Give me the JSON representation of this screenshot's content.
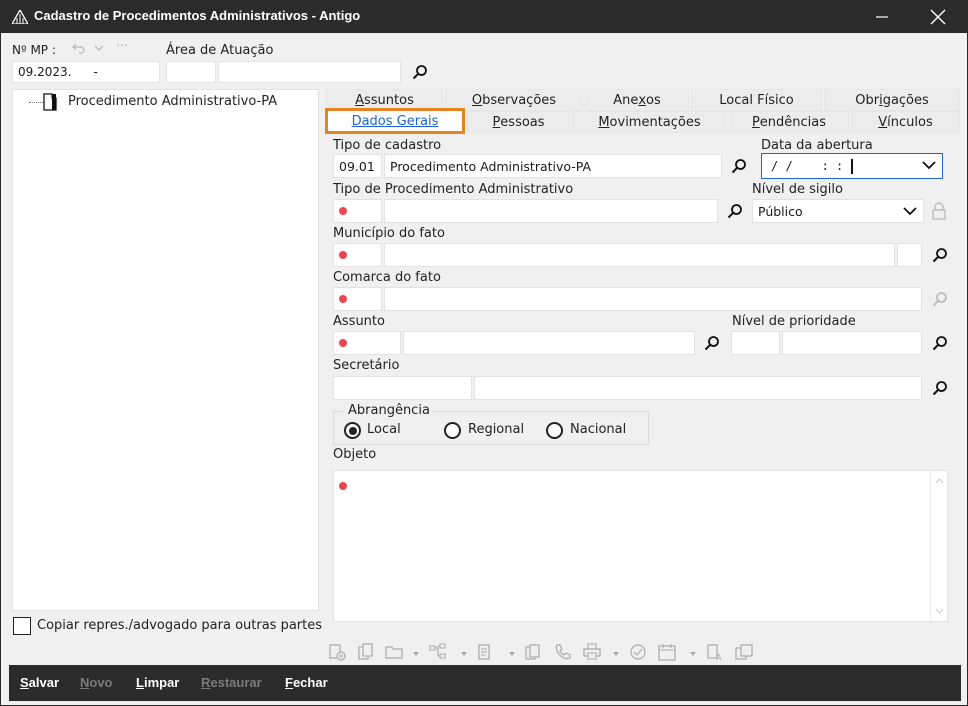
{
  "window": {
    "title": "Cadastro de Procedimentos Administrativos - Antigo"
  },
  "header": {
    "mp_label": "Nº MP :",
    "mp_value": "09.2023.",
    "mp_dash": "-",
    "area_label": "Área de Atuação",
    "area_code": "",
    "area_name": ""
  },
  "tree": {
    "root_label": "Procedimento Administrativo-PA"
  },
  "copy_checkbox": {
    "label": "Copiar repres./advogado para outras partes",
    "checked": false
  },
  "tabs_row1": [
    {
      "label": "Assuntos",
      "u": "A",
      "rest": "ssuntos"
    },
    {
      "label": "Observações",
      "u": "O",
      "rest": "bservações"
    },
    {
      "label": "Anexos",
      "pre": "Ane",
      "u": "x",
      "rest": "os"
    },
    {
      "label": "Local Físico"
    },
    {
      "label": "Obrigações",
      "pre": "Obr",
      "u": "i",
      "rest": "gações"
    }
  ],
  "tabs_row2": [
    {
      "label": "Dados Gerais",
      "active": true
    },
    {
      "label": "Pessoas",
      "u": "P",
      "rest": "essoas"
    },
    {
      "label": "Movimentações",
      "u": "M",
      "rest": "ovimentações"
    },
    {
      "label": "Pendências",
      "u": "P",
      "rest": "endências"
    },
    {
      "label": "Vínculos",
      "u": "V",
      "rest": "ínculos"
    }
  ],
  "form": {
    "tipo_cadastro_label": "Tipo de cadastro",
    "tipo_cadastro_code": "09.01",
    "tipo_cadastro_name": "Procedimento Administrativo-PA",
    "data_abertura_label": "Data da abertura",
    "data_abertura_value": "/ /    : :",
    "tipo_proc_label": "Tipo de Procedimento Administrativo",
    "nivel_sigilo_label": "Nível de sigilo",
    "nivel_sigilo_value": "Público",
    "municipio_label": "Município do fato",
    "comarca_label": "Comarca do fato",
    "assunto_label": "Assunto",
    "nivel_prioridade_label": "Nível de prioridade",
    "secretario_label": "Secretário",
    "abrangencia_label": "Abrangência",
    "abrangencia_options": [
      "Local",
      "Regional",
      "Nacional"
    ],
    "abrangencia_selected": "Local",
    "objeto_label": "Objeto"
  },
  "colors": {
    "accent": "#1b66d2",
    "tab_highlight": "#e8841f",
    "required_dot": "#e8474f",
    "titlebar": "#2b2b2b"
  },
  "toolbar_icons": [
    "new-doc-icon",
    "copy-doc-icon",
    "folder-icon",
    "tree-icon",
    "document-icon",
    "file-stack-icon",
    "phone-icon",
    "print-icon",
    "check-icon",
    "calendar-icon",
    "doc-a-icon",
    "doc-stack-icon"
  ],
  "bottom_bar": [
    {
      "label": "Salvar",
      "u": "S",
      "rest": "alvar",
      "enabled": true
    },
    {
      "label": "Novo",
      "u": "N",
      "rest": "ovo",
      "enabled": false
    },
    {
      "label": "Limpar",
      "u": "L",
      "rest": "impar",
      "enabled": true
    },
    {
      "label": "Restaurar",
      "u": "R",
      "rest": "estaurar",
      "enabled": false
    },
    {
      "label": "Fechar",
      "u": "F",
      "rest": "echar",
      "enabled": true
    }
  ]
}
